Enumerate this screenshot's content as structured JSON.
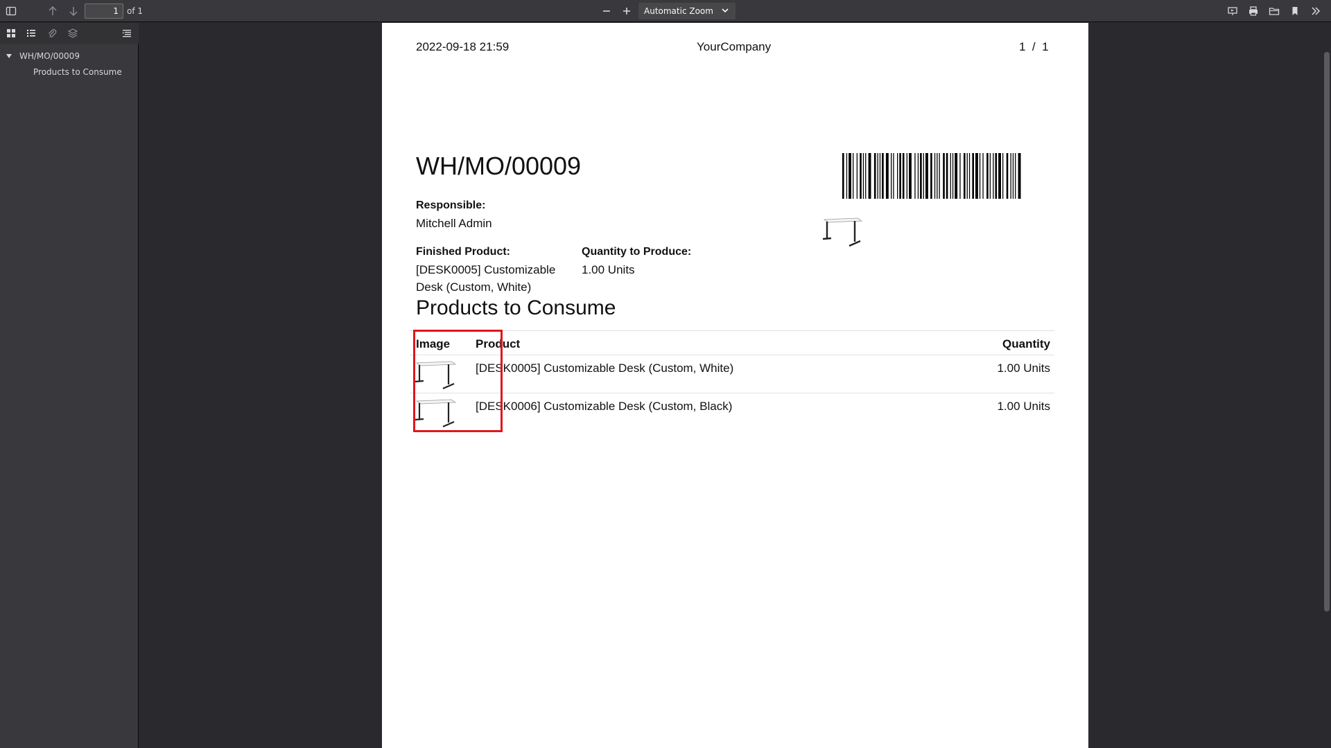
{
  "toolbar": {
    "page_number": "1",
    "page_of": "of 1",
    "zoom_label": "Automatic Zoom"
  },
  "sidebar": {
    "outline": [
      {
        "label": "WH/MO/00009"
      },
      {
        "label": "Products to Consume"
      }
    ]
  },
  "document": {
    "header": {
      "date": "2022-09-18 21:59",
      "company": "YourCompany",
      "page_current": "1",
      "page_sep": "/",
      "page_total": "1"
    },
    "title": "WH/MO/00009",
    "responsible_label": "Responsible:",
    "responsible_value": "Mitchell Admin",
    "finished_label": "Finished Product:",
    "finished_value_line1": "[DESK0005] Customizable",
    "finished_value_line2": "Desk (Custom, White)",
    "qty_label": "Quantity to Produce:",
    "qty_value": "1.00 Units",
    "section_title": "Products to Consume",
    "table": {
      "headers": {
        "image": "Image",
        "product": "Product",
        "quantity": "Quantity"
      },
      "rows": [
        {
          "product": "[DESK0005] Customizable Desk (Custom, White)",
          "quantity": "1.00 Units"
        },
        {
          "product": "[DESK0006] Customizable Desk (Custom, Black)",
          "quantity": "1.00 Units"
        }
      ]
    }
  },
  "colors": {
    "highlight": "#e0161b",
    "toolbar_bg": "#38383d",
    "viewer_bg": "#2a2a2e"
  }
}
